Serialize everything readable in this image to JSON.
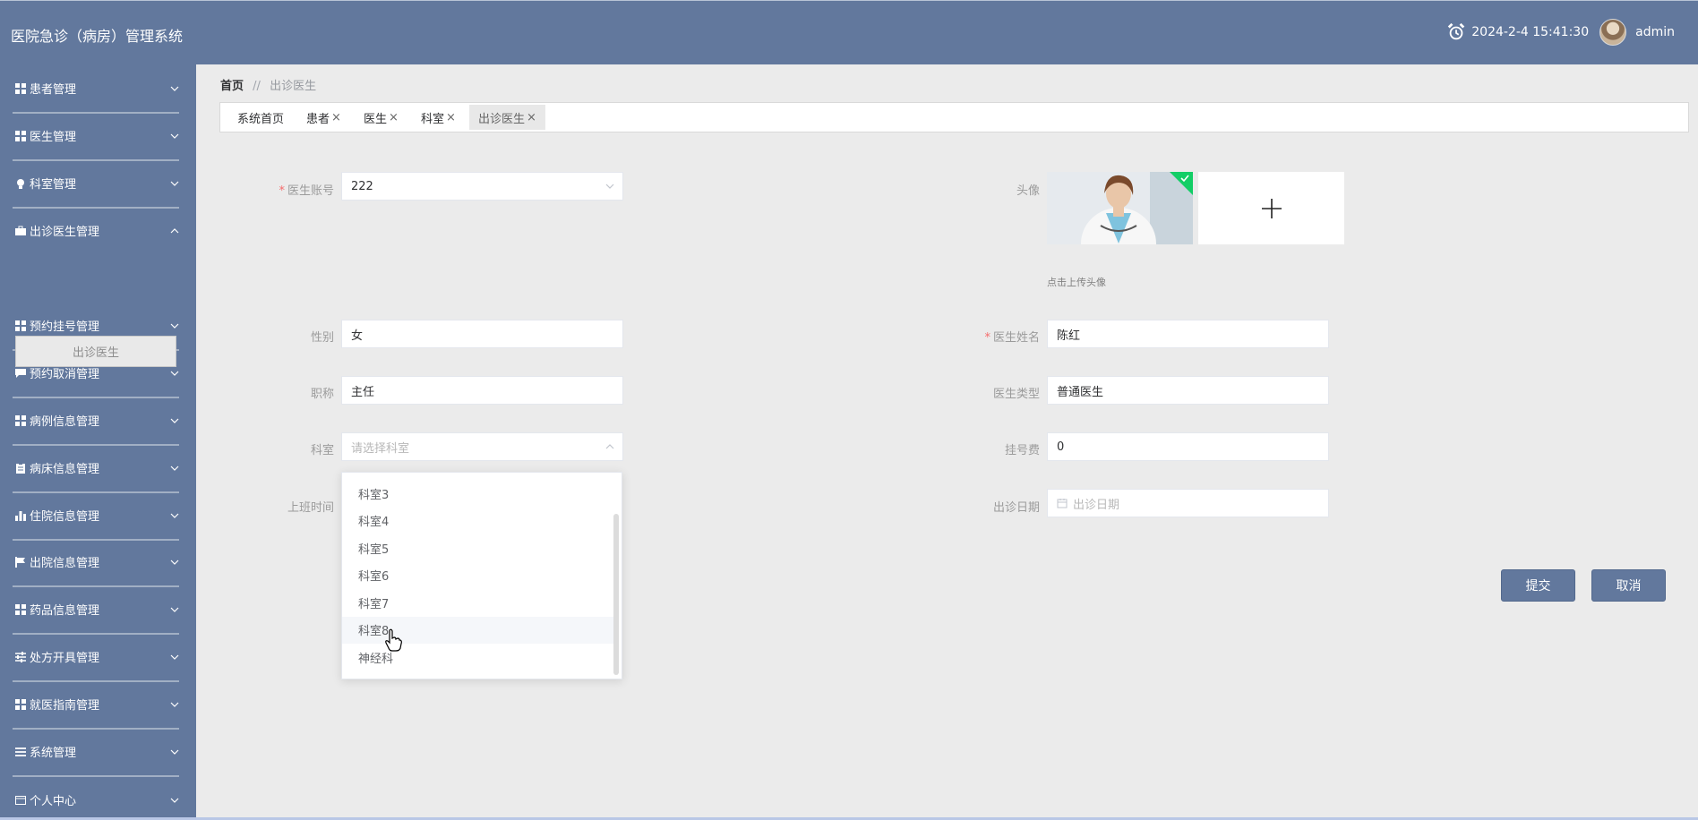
{
  "app": {
    "title": "医院急诊（病房）管理系统",
    "datetime": "2024-2-4 15:41:30",
    "username": "admin"
  },
  "sidebar": {
    "items": [
      {
        "label": "患者管理",
        "icon": "grid-icon"
      },
      {
        "label": "医生管理",
        "icon": "grid-icon"
      },
      {
        "label": "科室管理",
        "icon": "bulb-icon"
      },
      {
        "label": "出诊医生管理",
        "icon": "suitcase-icon",
        "expanded": true
      },
      {
        "label": "预约挂号管理",
        "icon": "grid-icon"
      },
      {
        "label": "预约取消管理",
        "icon": "chat-icon"
      },
      {
        "label": "病例信息管理",
        "icon": "grid-icon"
      },
      {
        "label": "病床信息管理",
        "icon": "clipboard-icon"
      },
      {
        "label": "住院信息管理",
        "icon": "bar-chart-icon"
      },
      {
        "label": "出院信息管理",
        "icon": "flag-icon"
      },
      {
        "label": "药品信息管理",
        "icon": "grid-icon"
      },
      {
        "label": "处方开具管理",
        "icon": "sliders-icon"
      },
      {
        "label": "就医指南管理",
        "icon": "grid-icon"
      },
      {
        "label": "系统管理",
        "icon": "list-icon"
      },
      {
        "label": "个人中心",
        "icon": "card-icon"
      }
    ],
    "submenu": {
      "label": "出诊医生"
    }
  },
  "breadcrumb": {
    "home": "首页",
    "separator": "//",
    "current": "出诊医生"
  },
  "tabs": [
    {
      "label": "系统首页",
      "closable": false
    },
    {
      "label": "患者",
      "closable": true
    },
    {
      "label": "医生",
      "closable": true
    },
    {
      "label": "科室",
      "closable": true
    },
    {
      "label": "出诊医生",
      "closable": true,
      "active": true
    }
  ],
  "tab_close_glyph": "×",
  "form": {
    "doctor_account": {
      "label": "医生账号",
      "value": "222",
      "required": true
    },
    "avatar": {
      "label": "头像",
      "hint": "点击上传头像"
    },
    "gender": {
      "label": "性别",
      "value": "女"
    },
    "doctor_name": {
      "label": "医生姓名",
      "value": "陈红",
      "required": true
    },
    "title": {
      "label": "职称",
      "value": "主任"
    },
    "doctor_type": {
      "label": "医生类型",
      "value": "普通医生"
    },
    "department": {
      "label": "科室",
      "placeholder": "请选择科室"
    },
    "registration_fee": {
      "label": "挂号费",
      "value": "0"
    },
    "shift_time": {
      "label": "上班时间"
    },
    "visit_date": {
      "label": "出诊日期",
      "placeholder": "出诊日期"
    }
  },
  "required_mark": "*",
  "department_options": [
    "科室3",
    "科室4",
    "科室5",
    "科室6",
    "科室7",
    "科室8",
    "神经科"
  ],
  "hovered_option": "科室8",
  "buttons": {
    "submit": "提交",
    "cancel": "取消"
  },
  "colors": {
    "primary": "#62789d",
    "background": "#ebebeb",
    "required": "#f56c6c",
    "upload_badge": "#13ce66"
  }
}
